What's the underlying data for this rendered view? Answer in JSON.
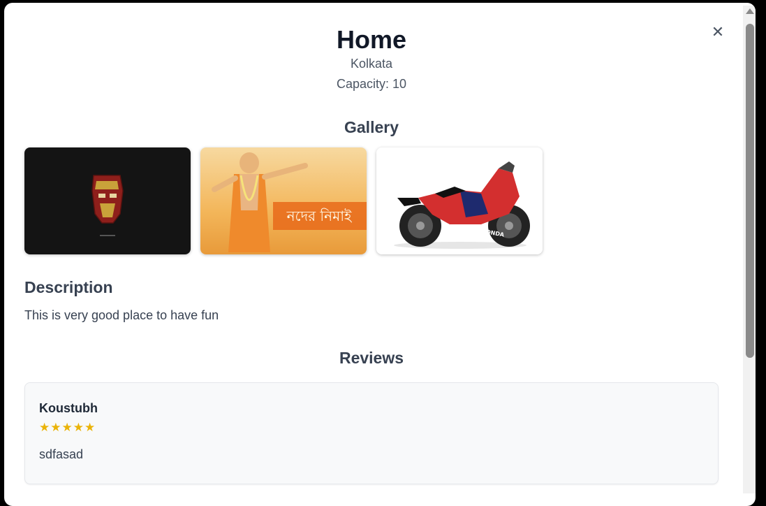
{
  "modal": {
    "title": "Home",
    "location": "Kolkata",
    "capacity_label": "Capacity:",
    "capacity_value": "10",
    "close_icon": "close-icon"
  },
  "gallery": {
    "heading": "Gallery",
    "images": [
      {
        "name": "iron-man-helmet-image",
        "background": "#141414",
        "accent": "#c0392b"
      },
      {
        "name": "devotional-poster-image",
        "background": "#f4b860",
        "accent": "#e86a1a",
        "caption": "নদের নিমাই"
      },
      {
        "name": "red-motorcycle-image",
        "background": "#ffffff",
        "accent": "#d32f2f",
        "brand": "HONDA"
      }
    ]
  },
  "description": {
    "heading": "Description",
    "text": "This is very good place to have fun"
  },
  "reviews": {
    "heading": "Reviews",
    "items": [
      {
        "author": "Koustubh",
        "stars": "★★★★★",
        "rating": 5,
        "text": "sdfasad"
      }
    ]
  },
  "colors": {
    "star": "#eab308",
    "title": "#111827",
    "card_bg": "#f8f9fa"
  }
}
